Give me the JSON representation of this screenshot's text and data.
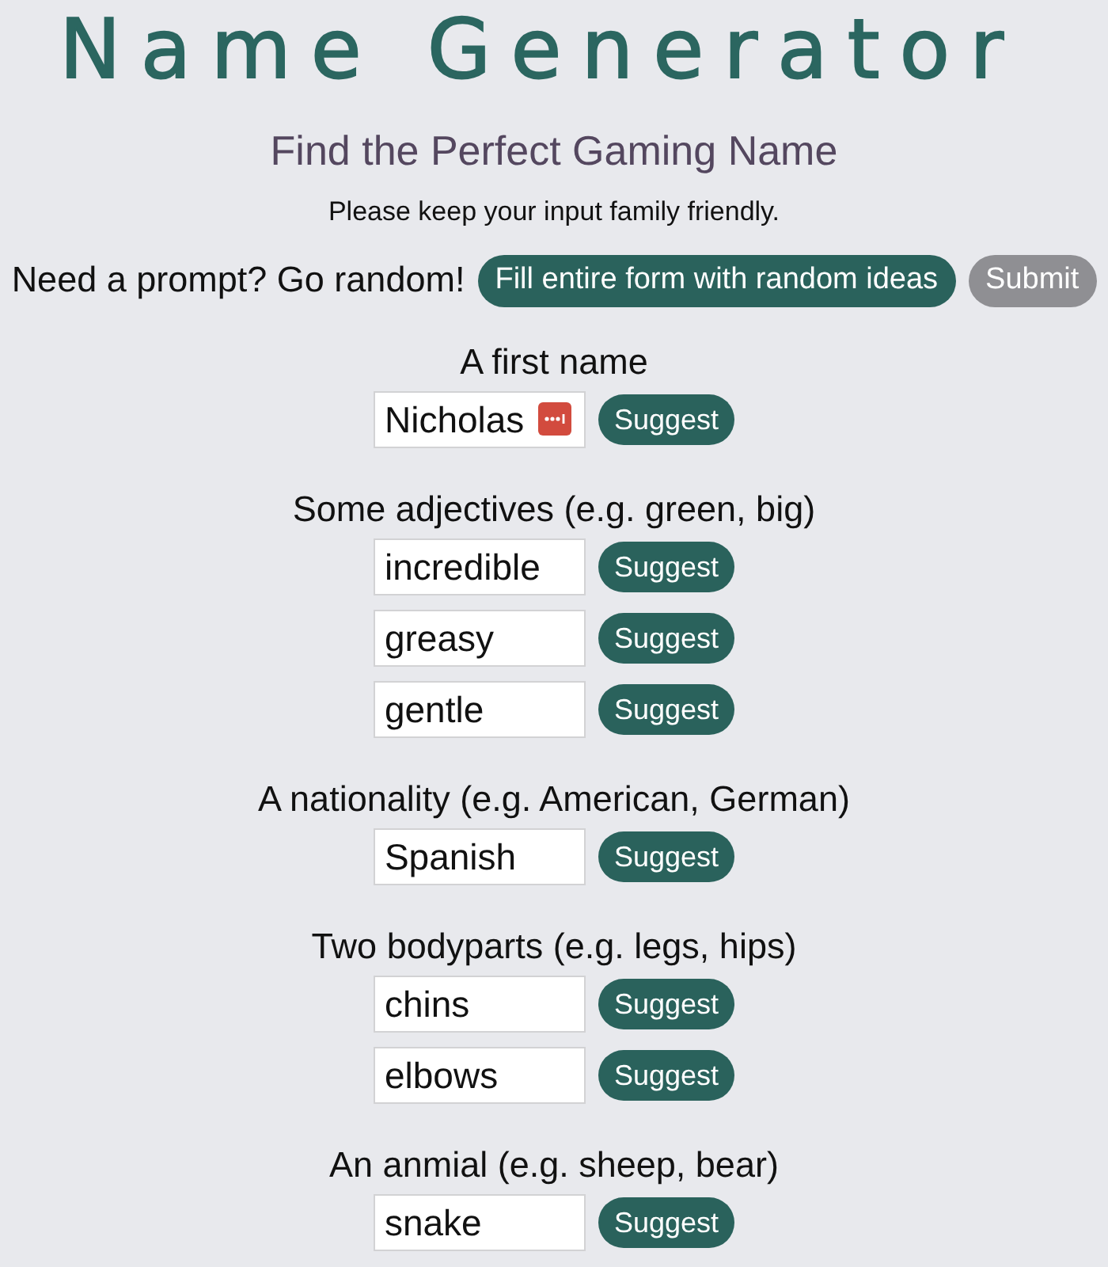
{
  "title": "Name Generator",
  "subtitle": "Find the Perfect Gaming Name",
  "note": "Please keep your input family friendly.",
  "prompt": {
    "text": "Need a prompt? Go random!",
    "random_button": "Fill entire form with random ideas",
    "submit_button": {
      "label": "Submit",
      "disabled": true
    }
  },
  "sections": [
    {
      "label": "A first name",
      "fields": [
        {
          "value": "Nicholas",
          "autofill_icon": true,
          "button": "Suggest"
        }
      ]
    },
    {
      "label": "Some adjectives (e.g. green, big)",
      "fields": [
        {
          "value": "incredible",
          "autofill_icon": false,
          "button": "Suggest"
        },
        {
          "value": "greasy",
          "autofill_icon": false,
          "button": "Suggest"
        },
        {
          "value": "gentle",
          "autofill_icon": false,
          "button": "Suggest"
        }
      ]
    },
    {
      "label": "A nationality (e.g. American, German)",
      "fields": [
        {
          "value": "Spanish",
          "autofill_icon": false,
          "button": "Suggest"
        }
      ]
    },
    {
      "label": "Two bodyparts (e.g. legs, hips)",
      "fields": [
        {
          "value": "chins",
          "autofill_icon": false,
          "button": "Suggest"
        },
        {
          "value": "elbows",
          "autofill_icon": false,
          "button": "Suggest"
        }
      ]
    },
    {
      "label": "An anmial (e.g. sheep, bear)",
      "fields": [
        {
          "value": "snake",
          "autofill_icon": false,
          "button": "Suggest"
        }
      ]
    }
  ]
}
